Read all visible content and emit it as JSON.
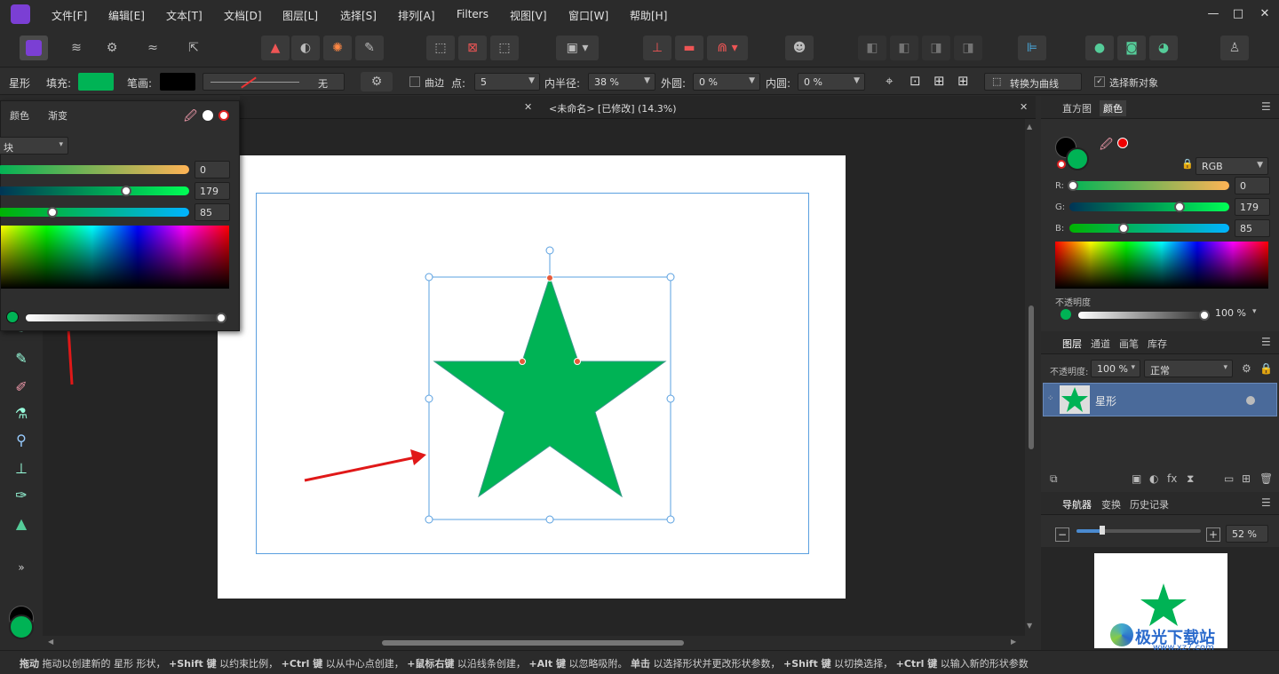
{
  "menubar": {
    "items": [
      "文件[F]",
      "编辑[E]",
      "文本[T]",
      "文档[D]",
      "图层[L]",
      "选择[S]",
      "排列[A]",
      "Filters",
      "视图[V]",
      "窗口[W]",
      "帮助[H]"
    ],
    "minimize": "—",
    "maximize": "□",
    "close": "✕"
  },
  "context": {
    "shape_name": "星形",
    "fill_label": "填充:",
    "stroke_label": "笔画:",
    "stroke_none": "无",
    "curve_label": "曲边",
    "points_label": "点:",
    "points_value": "5",
    "inner_radius_label": "内半径:",
    "inner_radius_value": "38 %",
    "outer_circle_label": "外圆:",
    "outer_circle_value": "0 %",
    "inner_circle_label": "内圆:",
    "inner_circle_value": "0 %",
    "convert_button": "转换为曲线",
    "select_new_label": "选择新对象",
    "fill_color": "#00b355",
    "stroke_color": "#000000"
  },
  "document_tab": {
    "title": "<未命名> [已修改] (14.3%)",
    "close": "✕",
    "left_close": "✕"
  },
  "color_popup": {
    "tabs": [
      "颜色",
      "渐变"
    ],
    "mode": "块",
    "r_value": "0",
    "g_value": "179",
    "b_value": "85",
    "r": 0,
    "g": 179,
    "b": 85
  },
  "right_panel": {
    "top_tabs": [
      "直方图",
      "颜色"
    ],
    "color_model": "RGB",
    "r_label": "R:",
    "g_label": "G:",
    "b_label": "B:",
    "r_value": "0",
    "g_value": "179",
    "b_value": "85",
    "opacity_label": "不透明度",
    "opacity_value": "100 %",
    "layer_tabs": [
      "图层",
      "通道",
      "画笔",
      "库存"
    ],
    "layer_opacity_label": "不透明度:",
    "layer_opacity_value": "100 %",
    "blend_mode": "正常",
    "layer_name": "星形",
    "nav_tabs": [
      "导航器",
      "变换",
      "历史记录"
    ],
    "zoom_value": "52 %"
  },
  "status": {
    "text_parts": [
      {
        "b": "拖动",
        "t": " 拖动以创建新的 星形 形状，"
      },
      {
        "b": "+Shift 键",
        "t": " 以约束比例，"
      },
      {
        "b": "+Ctrl 键",
        "t": " 以从中心点创建，"
      },
      {
        "b": "+鼠标右键",
        "t": " 以沿线条创建，"
      },
      {
        "b": "+Alt 键",
        "t": " 以忽略吸附。"
      },
      {
        "b": "单击",
        "t": " 以选择形状并更改形状参数，"
      },
      {
        "b": "+Shift 键",
        "t": " 以切换选择，"
      },
      {
        "b": "+Ctrl 键",
        "t": " 以输入新的形状参数"
      }
    ]
  },
  "watermark": {
    "text": "极光下载站",
    "url": "www.xz7.com"
  },
  "colors": {
    "accent": "#7b3fd4",
    "star": "#00b355",
    "selection": "#5aa0e0",
    "arrow": "#e01818",
    "layer_selected": "#4a6a9a"
  }
}
